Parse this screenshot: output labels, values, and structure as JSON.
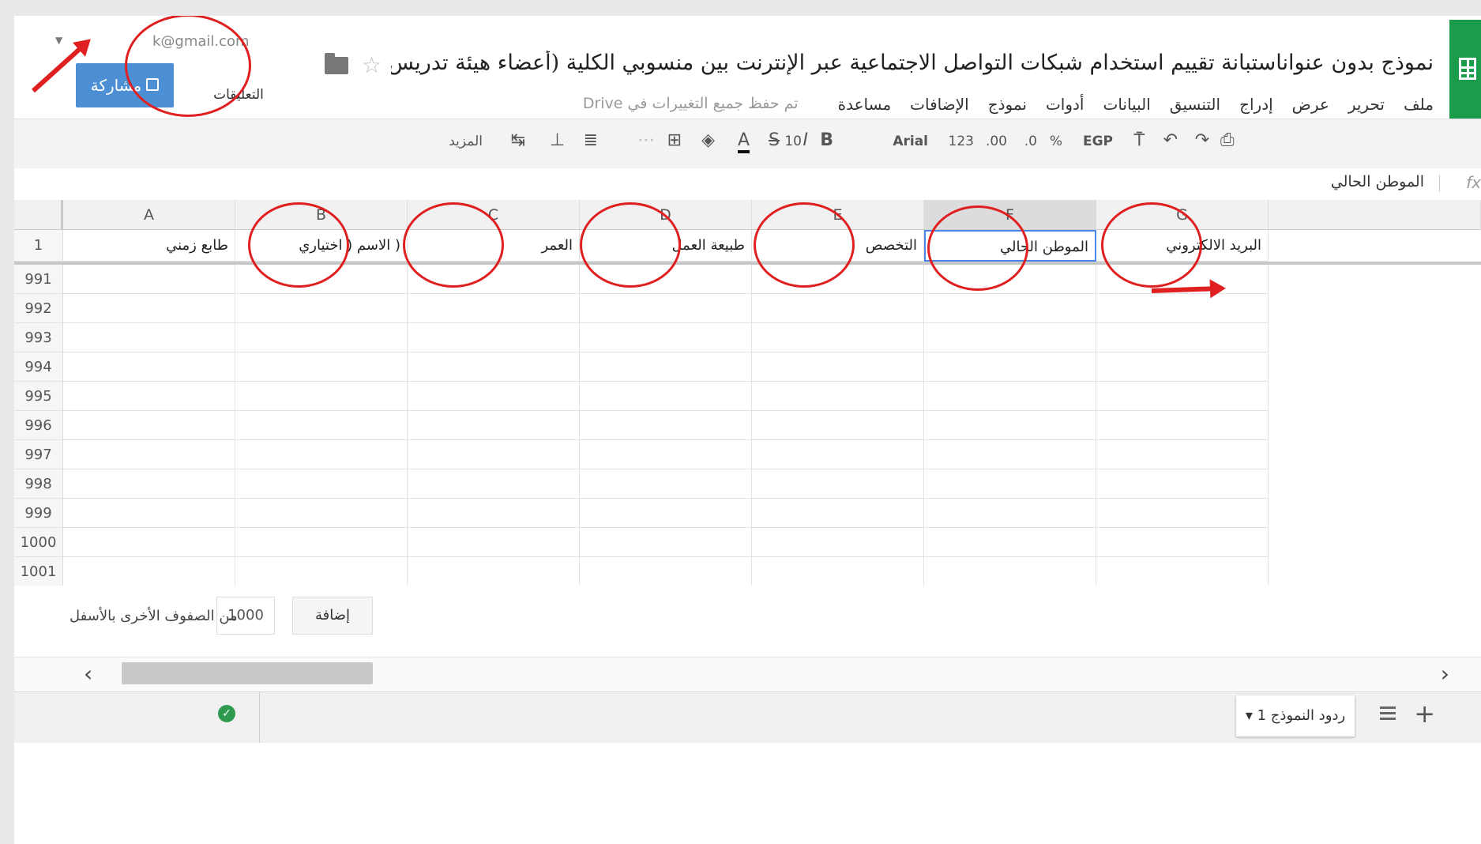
{
  "header": {
    "doc_title": "نموذج بدون عنواناستبانة تقييم استخدام شبكات التواصل الاجتماعية عبر الإنترنت بين منسوبي الكلية (أعضاء هيئة تدريس ، ومو...",
    "account_email": "k@gmail.com",
    "share_label": "مشاركة",
    "comments_label": "التعليقات",
    "menu": [
      "ملف",
      "تحرير",
      "عرض",
      "إدراج",
      "التنسيق",
      "البيانات",
      "أدوات",
      "نموذج",
      "الإضافات",
      "مساعدة"
    ],
    "save_status": "تم حفظ جميع التغييرات في Drive"
  },
  "toolbar": {
    "currency": "EGP",
    "percent": "%",
    "dec_decrease": ".0",
    "dec_increase": ".00",
    "more_formats": "123",
    "font": "Arial",
    "font_size": "10",
    "more_label": "المزيد"
  },
  "formula_bar": {
    "fx": "fx",
    "value": "الموطن الحالي"
  },
  "grid": {
    "columns": [
      "A",
      "B",
      "C",
      "D",
      "E",
      "F",
      "G"
    ],
    "header_row_number": "1",
    "header_cells": [
      "طابع زمني",
      "( الاسم ( اختياري",
      "العمر",
      "طبيعة العمل",
      "التخصص",
      "الموطن الحالي",
      "البريد الالكتروني"
    ],
    "row_numbers": [
      "991",
      "992",
      "993",
      "994",
      "995",
      "996",
      "997",
      "998",
      "999",
      "1000",
      "1001"
    ]
  },
  "add_rows": {
    "button_label": "إضافة",
    "count": "1000",
    "label": "من الصفوف الأخرى بالأسفل"
  },
  "tabs": {
    "sheet_name": "ردود النموذج 1"
  },
  "colors": {
    "accent": "#4d8fd4",
    "annotation": "#e02020",
    "sheets_green": "#1a9c4a"
  }
}
